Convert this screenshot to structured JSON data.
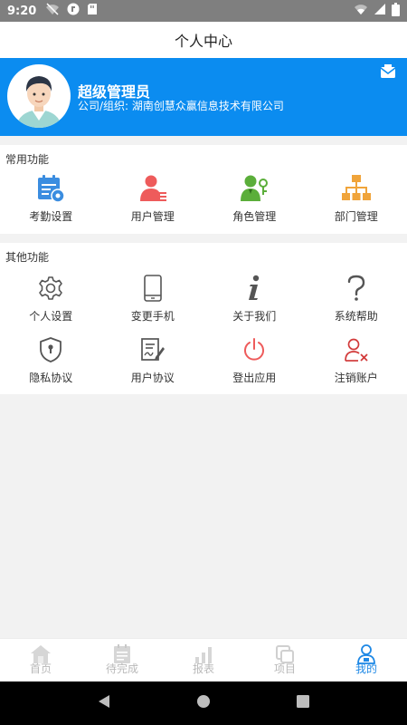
{
  "status_bar": {
    "time": "9:20"
  },
  "header": {
    "title": "个人中心"
  },
  "profile": {
    "name": "超级管理员",
    "company": "公司/组织: 湖南创慧众赢信息技术有限公司"
  },
  "common": {
    "title": "常用功能",
    "items": [
      {
        "label": "考勤设置",
        "icon": "calendar-settings-icon",
        "color": "#3b8de0"
      },
      {
        "label": "用户管理",
        "icon": "user-list-icon",
        "color": "#ee5b5b"
      },
      {
        "label": "角色管理",
        "icon": "user-key-icon",
        "color": "#5bae3a"
      },
      {
        "label": "部门管理",
        "icon": "org-chart-icon",
        "color": "#f0a43a"
      }
    ]
  },
  "other": {
    "title": "其他功能",
    "items": [
      {
        "label": "个人设置",
        "icon": "gear-icon"
      },
      {
        "label": "变更手机",
        "icon": "phone-icon"
      },
      {
        "label": "关于我们",
        "icon": "info-icon"
      },
      {
        "label": "系统帮助",
        "icon": "question-icon"
      },
      {
        "label": "隐私协议",
        "icon": "shield-lock-icon"
      },
      {
        "label": "用户协议",
        "icon": "document-edit-icon"
      },
      {
        "label": "登出应用",
        "icon": "power-icon"
      },
      {
        "label": "注销账户",
        "icon": "user-remove-icon"
      }
    ]
  },
  "tabbar": {
    "tabs": [
      {
        "label": "首页",
        "icon": "home-icon"
      },
      {
        "label": "待完成",
        "icon": "todo-list-icon"
      },
      {
        "label": "报表",
        "icon": "bar-chart-icon"
      },
      {
        "label": "项目",
        "icon": "project-icon"
      },
      {
        "label": "我的",
        "icon": "user-icon"
      }
    ],
    "active_color": "#1e88e5"
  },
  "theme": {
    "accent": "#0b8cf0"
  }
}
